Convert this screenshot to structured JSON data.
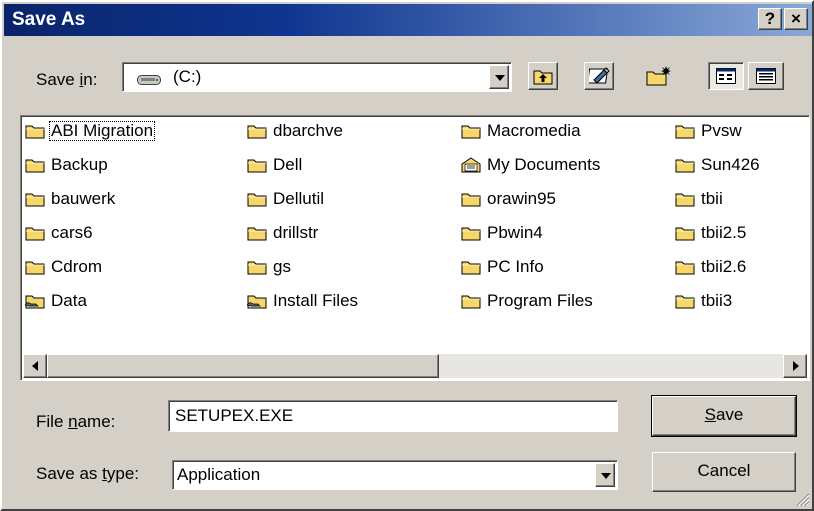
{
  "window": {
    "title": "Save As",
    "help_label": "?",
    "close_label": "×"
  },
  "save_in": {
    "label_pre": "Save ",
    "label_key": "i",
    "label_post": "n:",
    "value": "(C:)"
  },
  "toolbar": {
    "up_icon": "up-one-level-icon",
    "desktop_icon": "desktop-icon",
    "new_folder_icon": "new-folder-icon",
    "list_icon": "list-view-icon",
    "details_icon": "details-view-icon"
  },
  "files": [
    [
      {
        "name": "ABI Migration",
        "icon": "folder"
      },
      {
        "name": "Backup",
        "icon": "folder"
      },
      {
        "name": "bauwerk",
        "icon": "folder"
      },
      {
        "name": "cars6",
        "icon": "folder"
      },
      {
        "name": "Cdrom",
        "icon": "folder"
      },
      {
        "name": "Data",
        "icon": "shared-folder"
      }
    ],
    [
      {
        "name": "dbarchve",
        "icon": "folder"
      },
      {
        "name": "Dell",
        "icon": "folder"
      },
      {
        "name": "Dellutil",
        "icon": "folder"
      },
      {
        "name": "drillstr",
        "icon": "folder"
      },
      {
        "name": "gs",
        "icon": "folder"
      },
      {
        "name": "Install Files",
        "icon": "shared-folder"
      }
    ],
    [
      {
        "name": "Macromedia",
        "icon": "folder"
      },
      {
        "name": "My Documents",
        "icon": "my-documents"
      },
      {
        "name": "orawin95",
        "icon": "folder"
      },
      {
        "name": "Pbwin4",
        "icon": "folder"
      },
      {
        "name": "PC Info",
        "icon": "folder"
      },
      {
        "name": "Program Files",
        "icon": "folder"
      }
    ],
    [
      {
        "name": "Pvsw",
        "icon": "folder"
      },
      {
        "name": "Sun426",
        "icon": "folder"
      },
      {
        "name": "tbii",
        "icon": "folder"
      },
      {
        "name": "tbii2.5",
        "icon": "folder"
      },
      {
        "name": "tbii2.6",
        "icon": "folder"
      },
      {
        "name": "tbii3",
        "icon": "folder"
      }
    ]
  ],
  "filename": {
    "label_pre": "File ",
    "label_key": "n",
    "label_post": "ame:",
    "value": "SETUPEX.EXE"
  },
  "filetype": {
    "label_pre": "Save as ",
    "label_key": "t",
    "label_post": "ype:",
    "value": "Application"
  },
  "buttons": {
    "save_key": "S",
    "save_rest": "ave",
    "cancel": "Cancel"
  },
  "colors": {
    "titlebar_start": "#0a246a",
    "titlebar_end": "#8aa8d8",
    "face": "#d4d0c8",
    "folder": "#f7d76b"
  }
}
